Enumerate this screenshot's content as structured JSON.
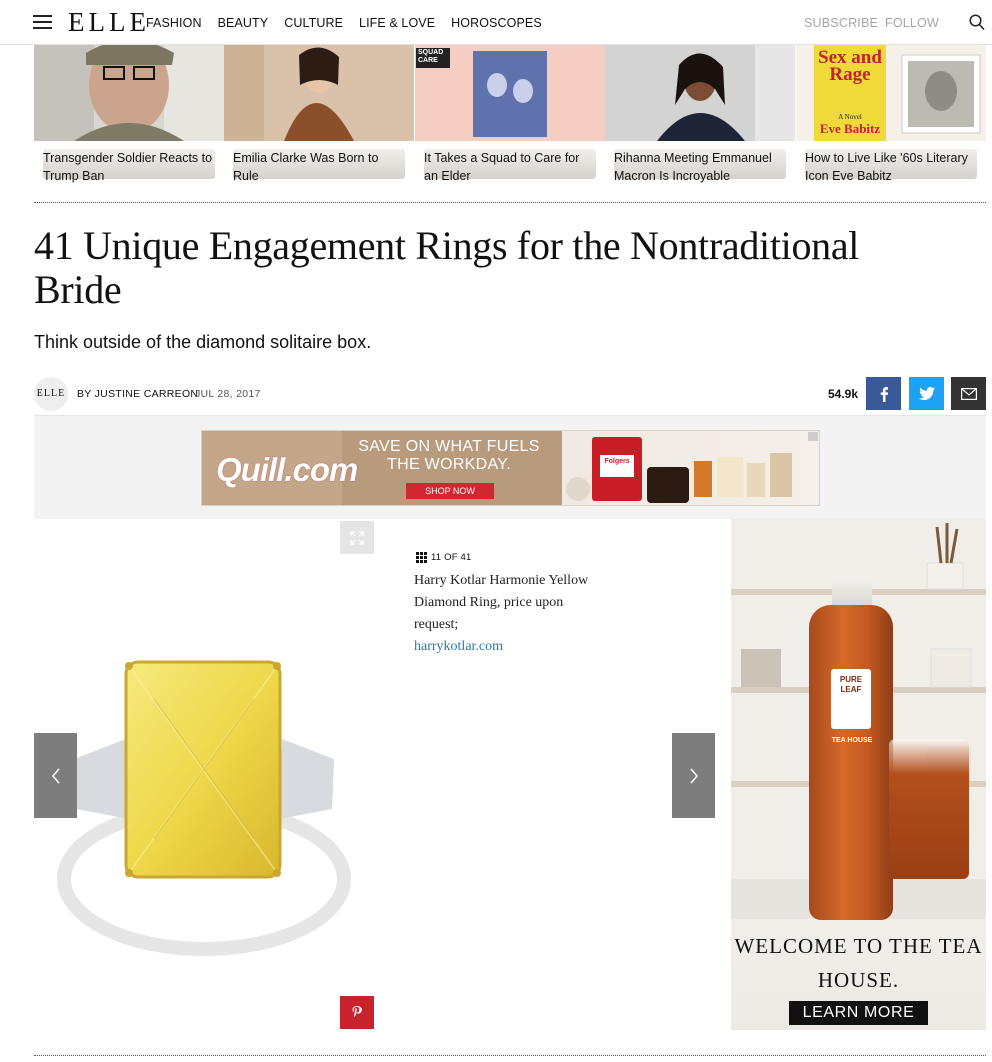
{
  "header": {
    "logo": "ELLE",
    "nav": [
      "FASHION",
      "BEAUTY",
      "CULTURE",
      "LIFE & LOVE",
      "HOROSCOPES"
    ],
    "subscribe": "SUBSCRIBE",
    "follow": "FOLLOW"
  },
  "related": [
    {
      "caption": "Transgender Soldier Reacts to Trump Ban"
    },
    {
      "caption": "Emilia Clarke Was Born to Rule"
    },
    {
      "caption": "It Takes a Squad to Care for an Elder",
      "badge_line1": "SQUAD",
      "badge_line2": "CARE"
    },
    {
      "caption": "Rihanna Meeting Emmanuel Macron Is Incroyable"
    },
    {
      "caption": "How to Live Like '60s Literary Icon Eve Babitz",
      "book_title": "Sex and Rage",
      "book_subtitle": "A Novel",
      "book_author": "Eve Babitz"
    }
  ],
  "article": {
    "title": "41 Unique Engagement Rings for the Nontraditional Bride",
    "dek": "Think outside of the diamond solitaire box.",
    "avatar": "ELLE",
    "byline": "BY JUSTINE CARREON",
    "date": "JUL 28, 2017",
    "share_count": "54.9k"
  },
  "banner_ad": {
    "brand": "Quill.com",
    "headline": "SAVE ON WHAT FUELS THE WORKDAY.",
    "cta": "SHOP NOW",
    "product": "Folgers"
  },
  "gallery": {
    "counter": "11 OF 41",
    "description": "Harry Kotlar Harmonie Yellow Diamond Ring, price upon request;",
    "link": "harrykotlar.com"
  },
  "side_ad": {
    "brand": "PURE LEAF",
    "sub": "TEA HOUSE",
    "headline": "WELCOME TO THE TEA HOUSE.",
    "cta": "LEARN MORE"
  },
  "colors": {
    "facebook": "#3b5998",
    "twitter": "#1da1f2",
    "pinterest": "#c8232c",
    "link": "#2b78a6"
  }
}
